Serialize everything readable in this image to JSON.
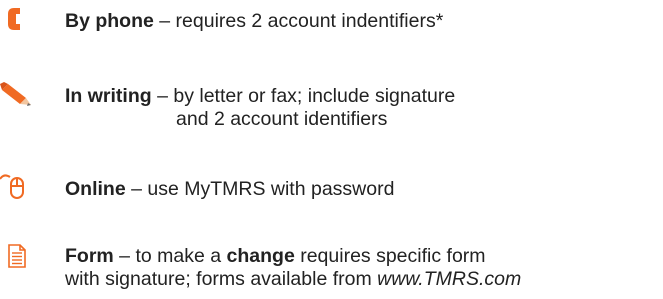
{
  "colors": {
    "accent": "#F06A23",
    "text": "#222222",
    "icon_gray": "#6B6B6B"
  },
  "items": [
    {
      "icon": "phone-icon",
      "title": "By phone",
      "dash": "–",
      "desc": "requires 2 account indentifiers*"
    },
    {
      "icon": "pencil-icon",
      "title": "In writing",
      "dash": "–",
      "desc_line1": "by letter or fax; include signature",
      "desc_line2": "and 2 account identifiers"
    },
    {
      "icon": "mouse-icon",
      "title": "Online",
      "dash": "–",
      "desc": "use MyTMRS with password"
    },
    {
      "icon": "document-icon",
      "title": "Form",
      "dash": "–",
      "desc_pre": "to make a",
      "desc_bold": "change",
      "desc_post": "requires specific form",
      "desc_line2": "with signature; forms available from",
      "website": "www.TMRS.com"
    }
  ]
}
